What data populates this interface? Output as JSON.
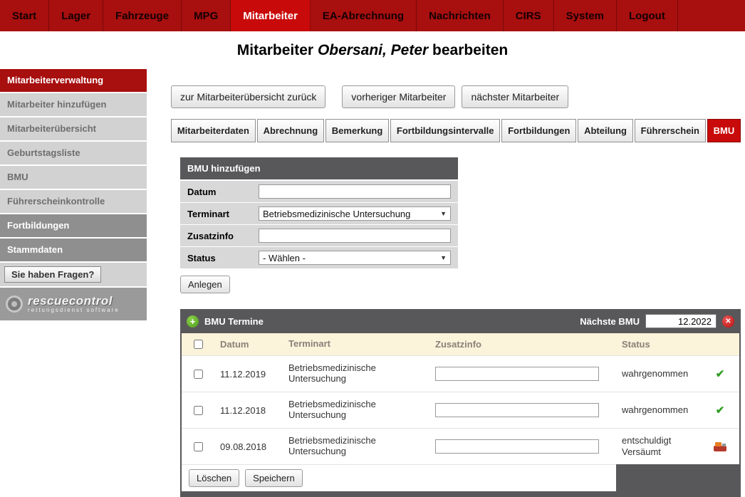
{
  "colors": {
    "nav_red": "#a80f0f",
    "active_red": "#c90a0a",
    "dark_gray": "#58585a",
    "light_gray": "#d2d2d2",
    "section_gray": "#8f8f8f",
    "cream_header": "#fbf3da",
    "check_green": "#2f9e22"
  },
  "topnav": {
    "items": [
      {
        "label": "Start",
        "active": false
      },
      {
        "label": "Lager",
        "active": false
      },
      {
        "label": "Fahrzeuge",
        "active": false
      },
      {
        "label": "MPG",
        "active": false
      },
      {
        "label": "Mitarbeiter",
        "active": true
      },
      {
        "label": "EA-Abrechnung",
        "active": false
      },
      {
        "label": "Nachrichten",
        "active": false
      },
      {
        "label": "CIRS",
        "active": false
      },
      {
        "label": "System",
        "active": false
      },
      {
        "label": "Logout",
        "active": false
      }
    ]
  },
  "page_title": {
    "prefix": "Mitarbeiter ",
    "name": "Obersani, Peter",
    "suffix": " bearbeiten"
  },
  "sidebar": {
    "items": [
      {
        "label": "Mitarbeiterverwaltung",
        "style": "header"
      },
      {
        "label": "Mitarbeiter hinzufügen",
        "style": "light"
      },
      {
        "label": "Mitarbeiterübersicht",
        "style": "light"
      },
      {
        "label": "Geburtstagsliste",
        "style": "light"
      },
      {
        "label": "BMU",
        "style": "light"
      },
      {
        "label": "Führerscheinkontrolle",
        "style": "light"
      },
      {
        "label": "Fortbildungen",
        "style": "section"
      },
      {
        "label": "Stammdaten",
        "style": "section"
      },
      {
        "label": "Sie haben Fragen?",
        "style": "help"
      }
    ],
    "logo": {
      "brand": "rescuecontrol",
      "tagline": "rettungsdienst software"
    }
  },
  "toolbar": {
    "back_label": "zur Mitarbeiterübersicht zurück",
    "prev_label": "vorheriger Mitarbeiter",
    "next_label": "nächster Mitarbeiter"
  },
  "tabs": [
    {
      "label": "Mitarbeiterdaten",
      "active": false
    },
    {
      "label": "Abrechnung",
      "active": false
    },
    {
      "label": "Bemerkung",
      "active": false
    },
    {
      "label": "Fortbildungsintervalle",
      "active": false
    },
    {
      "label": "Fortbildungen",
      "active": false
    },
    {
      "label": "Abteilung",
      "active": false
    },
    {
      "label": "Führerschein",
      "active": false
    },
    {
      "label": "BMU",
      "active": true
    }
  ],
  "form": {
    "title": "BMU hinzufügen",
    "fields": [
      {
        "label": "Datum",
        "type": "text",
        "value": ""
      },
      {
        "label": "Terminart",
        "type": "select",
        "value": "Betriebsmedizinische Untersuchung"
      },
      {
        "label": "Zusatzinfo",
        "type": "text",
        "value": ""
      },
      {
        "label": "Status",
        "type": "select",
        "value": "- Wählen -"
      }
    ],
    "submit_label": "Anlegen"
  },
  "bmu_table": {
    "title": "BMU Termine",
    "next_bmu_label": "Nächste BMU",
    "next_bmu_value": "12.2022",
    "columns": [
      "Datum",
      "Terminart",
      "Zusatzinfo",
      "Status"
    ],
    "rows": [
      {
        "datum": "11.12.2019",
        "terminart": "Betriebsmedizinische Untersuchung",
        "zusatzinfo": "",
        "status": "wahrgenommen",
        "status_icon": "check-icon"
      },
      {
        "datum": "11.12.2018",
        "terminart": "Betriebsmedizinische Untersuchung",
        "zusatzinfo": "",
        "status": "wahrgenommen",
        "status_icon": "check-icon"
      },
      {
        "datum": "09.08.2018",
        "terminart": "Betriebsmedizinische Untersuchung",
        "zusatzinfo": "",
        "status": "entschuldigt Versäumt",
        "status_icon": "excused-icon"
      }
    ],
    "delete_label": "Löschen",
    "save_label": "Speichern"
  },
  "icons": {
    "plus": "+",
    "close": "✕",
    "caret": "▼",
    "check": "✔"
  }
}
